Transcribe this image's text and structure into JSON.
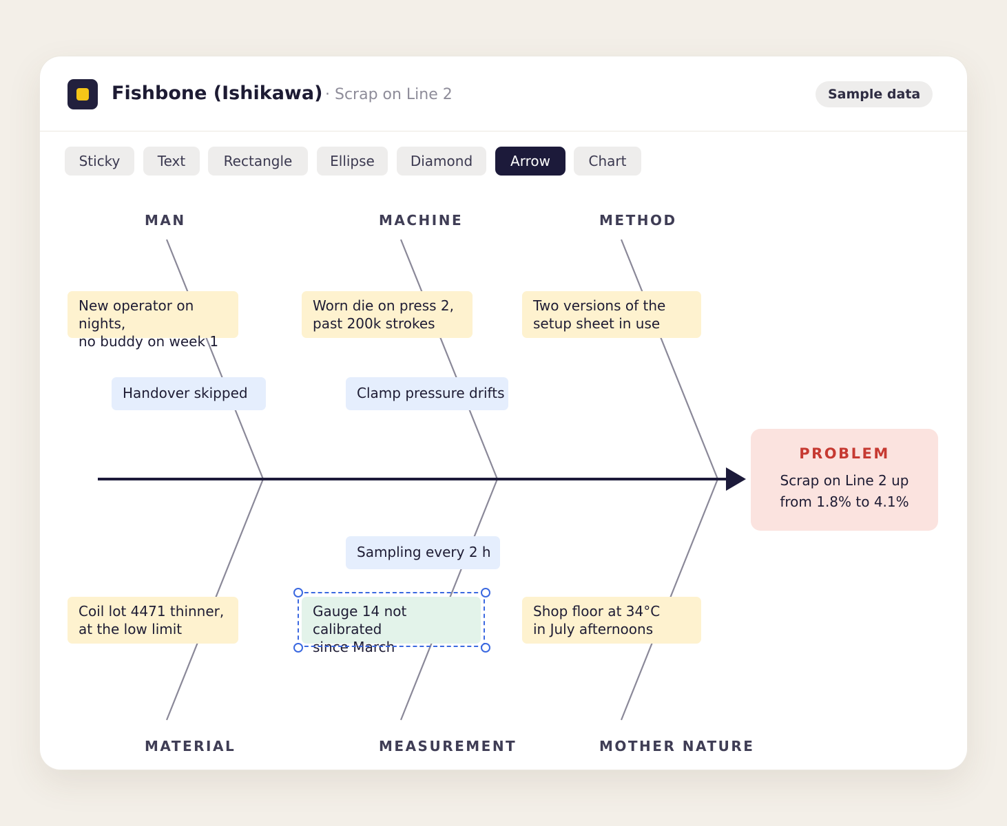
{
  "header": {
    "title": "Fishbone (Ishikawa)",
    "subtitle": "· Scrap on Line 2",
    "badge": "Sample data"
  },
  "toolbar": {
    "tools": [
      {
        "label": "Sticky",
        "active": false
      },
      {
        "label": "Text",
        "active": false
      },
      {
        "label": "Rectangle",
        "active": false
      },
      {
        "label": "Ellipse",
        "active": false
      },
      {
        "label": "Diamond",
        "active": false
      },
      {
        "label": "Arrow",
        "active": true
      },
      {
        "label": "Chart",
        "active": false
      }
    ]
  },
  "diagram": {
    "categories": {
      "top": [
        "MAN",
        "MACHINE",
        "METHOD"
      ],
      "bottom": [
        "MATERIAL",
        "MEASUREMENT",
        "MOTHER NATURE"
      ]
    },
    "causes": {
      "man": "New operator on nights,\nno buddy on week 1",
      "man_sub": "Handover skipped",
      "machine": "Worn die on press 2,\npast 200k strokes",
      "machine_sub": "Clamp pressure drifts",
      "method": "Two versions of the\nsetup sheet in use",
      "material": "Coil lot 4471 thinner,\nat the low limit",
      "measurement_sub": "Sampling every 2 h",
      "measurement": "Gauge 14 not calibrated\nsince March",
      "mother_nature": "Shop floor at 34°C\nin July afternoons"
    },
    "problem": {
      "label": "PROBLEM",
      "text": "Scrap on Line 2 up\nfrom 1.8% to 4.1%"
    },
    "colors": {
      "spine": "#1c1a3a",
      "bone": "#8a8898",
      "sticky_yellow": "#fef2cf",
      "sticky_blue": "#e5eefd",
      "sticky_green": "#e3f3ea",
      "problem_bg": "#fbe3df",
      "problem_accent": "#c63a32",
      "selection": "#3a68e0"
    }
  }
}
